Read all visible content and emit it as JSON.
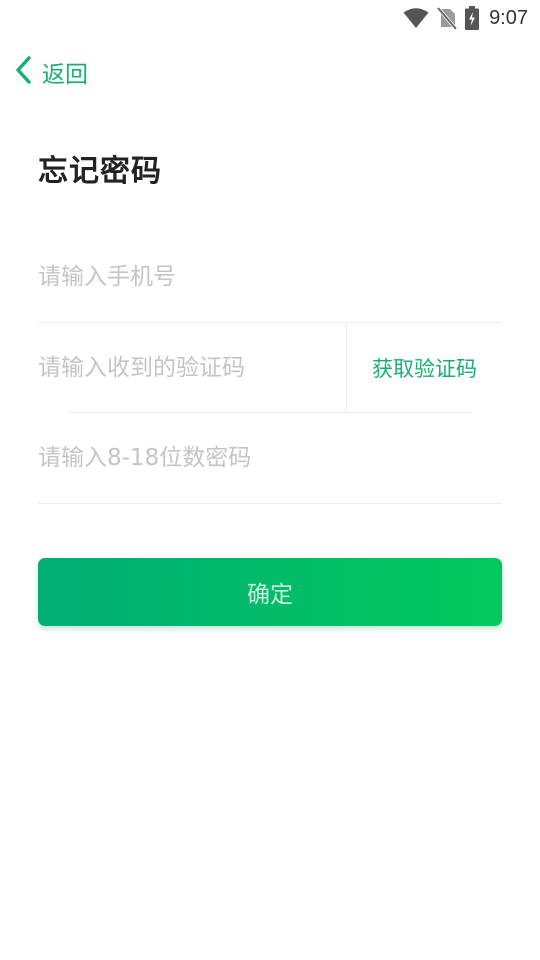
{
  "status_bar": {
    "time": "9:07",
    "icons": [
      "wifi-icon",
      "no-sim-icon",
      "battery-charging-icon"
    ]
  },
  "nav": {
    "back_label": "返回",
    "back_icon": "chevron-left-icon"
  },
  "page": {
    "title": "忘记密码"
  },
  "form": {
    "phone_placeholder": "请输入手机号",
    "phone_value": "",
    "code_placeholder": "请输入收到的验证码",
    "code_value": "",
    "get_code_label": "获取验证码",
    "password_placeholder": "请输入8-18位数密码",
    "password_value": ""
  },
  "actions": {
    "confirm_label": "确定"
  },
  "colors": {
    "accent": "#17b071",
    "button_gradient_start": "#00ad75",
    "button_gradient_end": "#03c95c",
    "placeholder": "#c4c4c4",
    "divider": "#ececec"
  }
}
